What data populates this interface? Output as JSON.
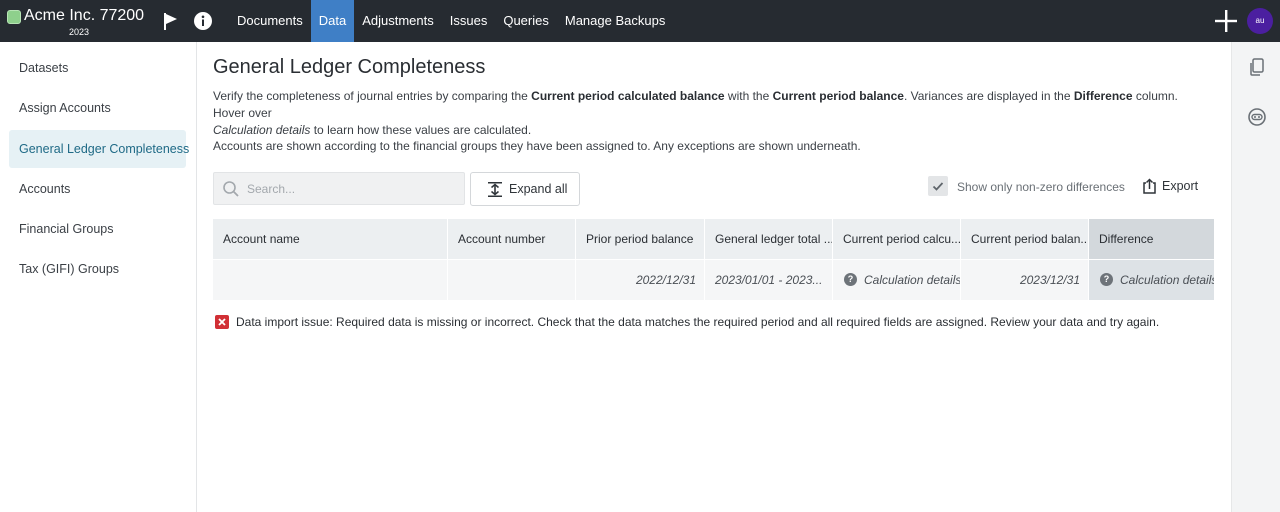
{
  "colors": {
    "topbar": "#262b31",
    "nav_active": "#3f7fc6",
    "sidebar_active_bg": "#e6f1f5",
    "sidebar_active_text": "#1f6a86",
    "error": "#d12f35",
    "avatar": "#4b1fa0"
  },
  "header": {
    "company": "Acme Inc. 77200",
    "year": "2023",
    "icons": [
      "flag-icon",
      "info-icon",
      "plus-icon"
    ],
    "nav": [
      "Documents",
      "Data",
      "Adjustments",
      "Issues",
      "Queries",
      "Manage Backups"
    ],
    "active_nav": "Data",
    "avatar": "au"
  },
  "sidebar": {
    "items": [
      "Datasets",
      "Assign Accounts",
      "General Ledger Completeness",
      "Accounts",
      "Financial Groups",
      "Tax (GIFI) Groups"
    ],
    "active": "General Ledger Completeness"
  },
  "rightrail": {
    "icons": [
      "copy-icon",
      "chat-icon"
    ]
  },
  "main": {
    "title": "General Ledger Completeness",
    "desc": {
      "p1": "Verify the completeness of journal entries by comparing the ",
      "b1": "Current period calculated balance",
      "p2": " with the ",
      "b2": "Current period balance",
      "p3": ". Variances are displayed in the ",
      "b3": "Difference",
      "p4": " column. Hover over ",
      "i1": "Calculation details",
      "p5": " to learn how these values are calculated."
    },
    "note": "Accounts are shown according to the financial groups they have been assigned to. Any exceptions are shown underneath.",
    "search_placeholder": "Search...",
    "expand_label": "Expand all",
    "toggle_label": "Show only non-zero differences",
    "toggle_checked": true,
    "export_label": "Export"
  },
  "table": {
    "headers": [
      "Account name",
      "Account number",
      "Prior period balance",
      "General ledger total ...",
      "Current period calcu...",
      "Current period balan...",
      "Difference"
    ],
    "row": {
      "account_name": "",
      "account_number": "",
      "prior": "2022/12/31",
      "gl_total": "2023/01/01 - 2023...",
      "calc": "Calculation details",
      "current": "2023/12/31",
      "difference": "Calculation details"
    }
  },
  "error": "Data import issue: Required data is missing or incorrect. Check that the data matches the required period and all required fields are assigned. Review your data and try again."
}
